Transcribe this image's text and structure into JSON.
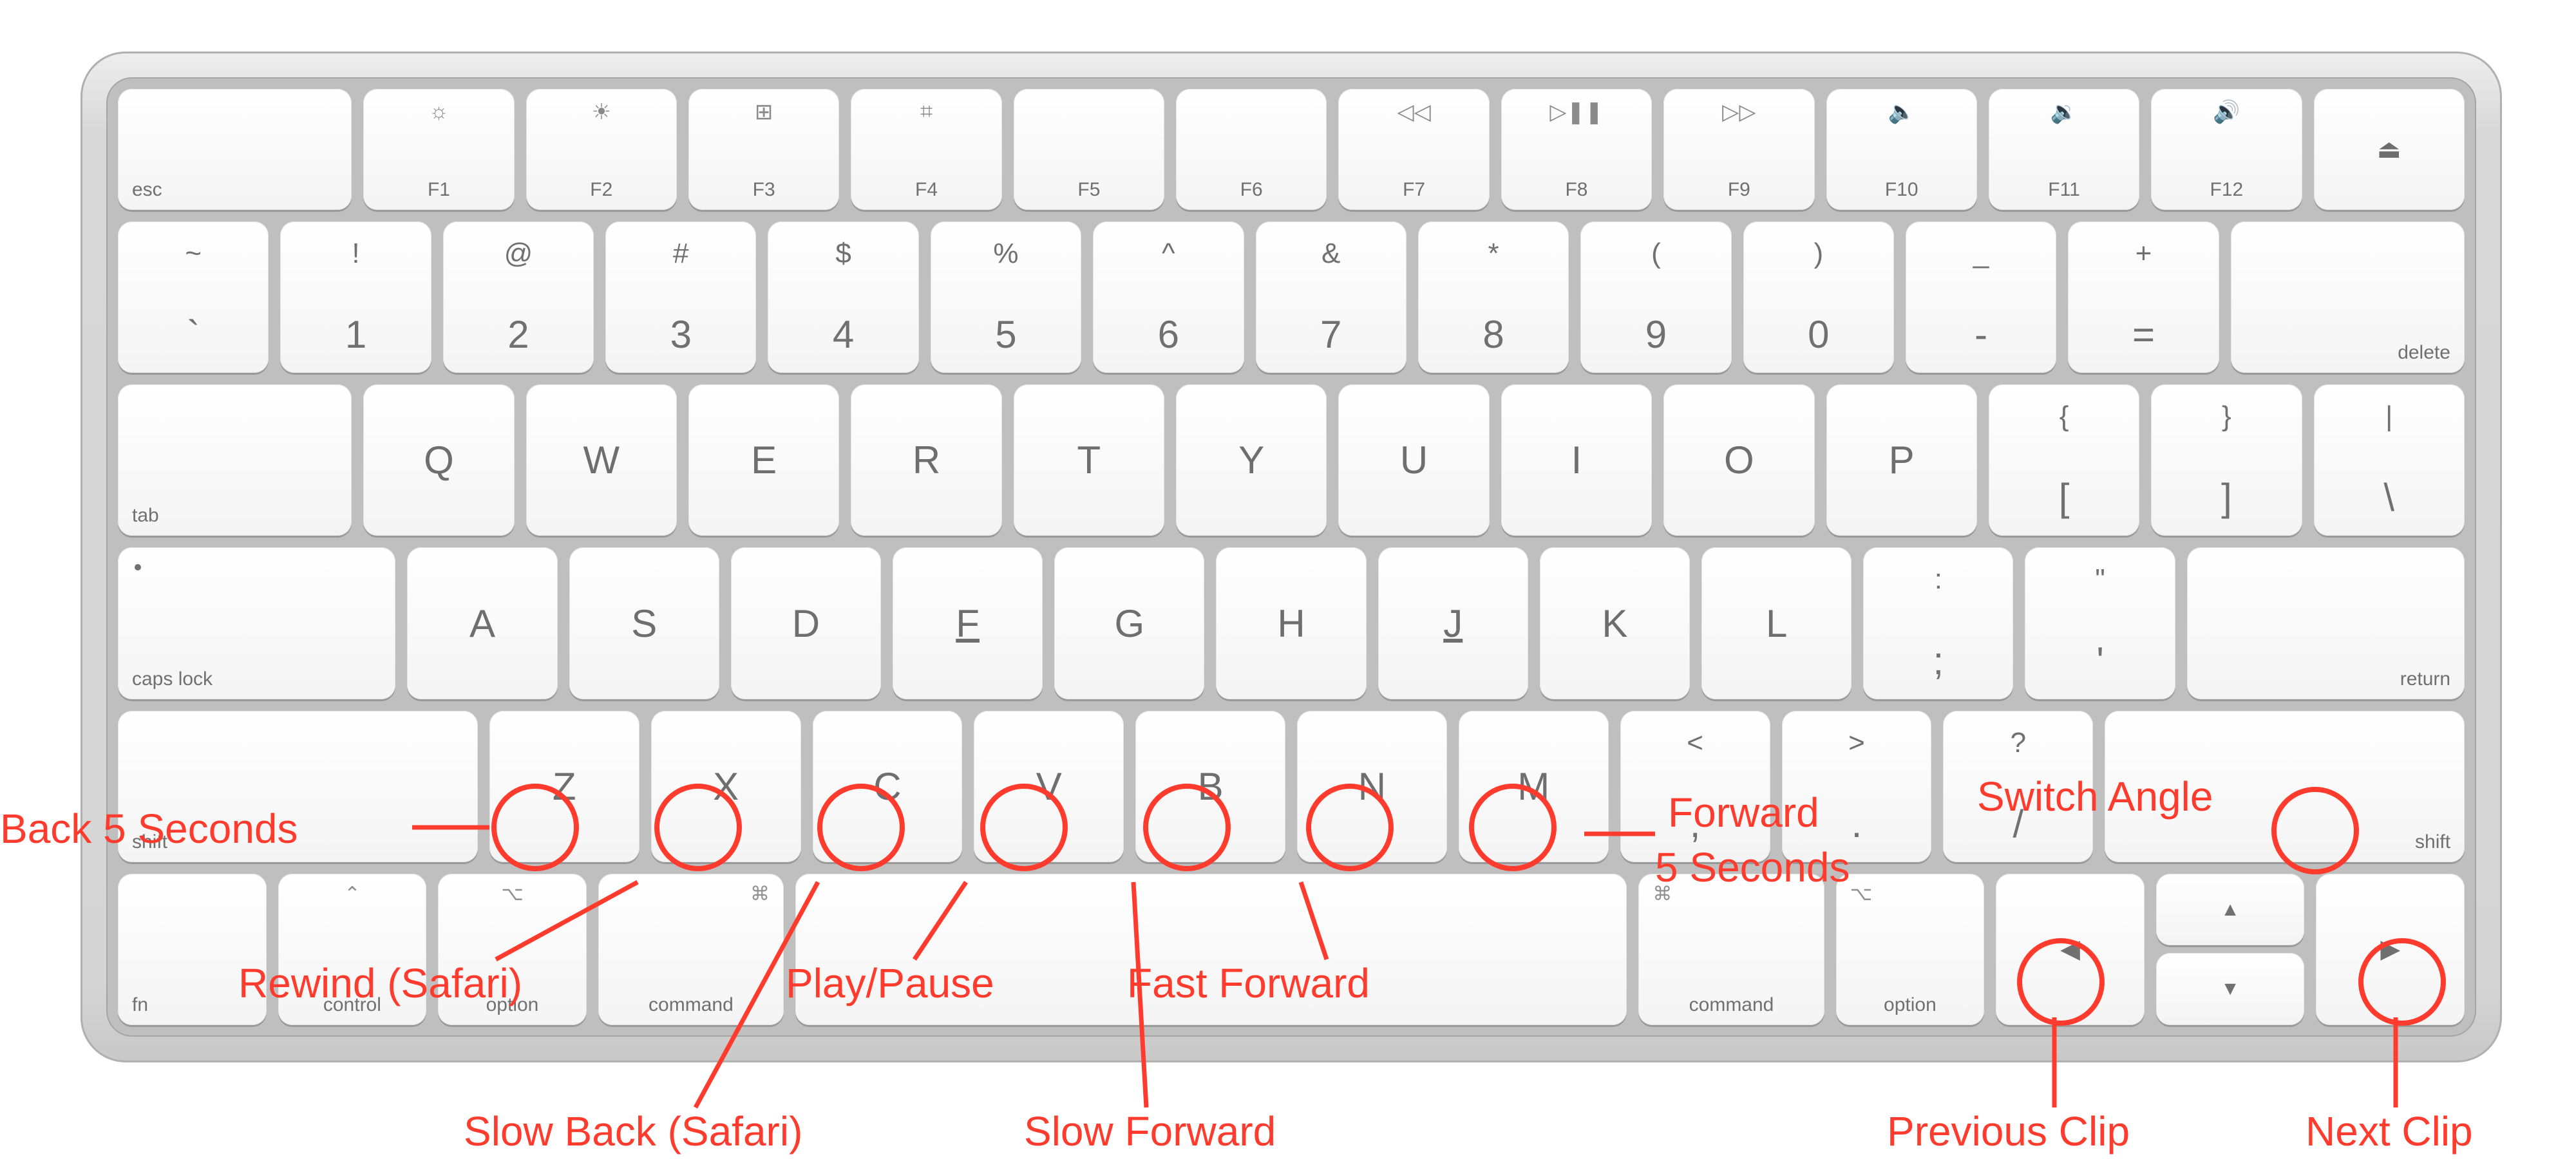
{
  "rowF": {
    "esc": "esc",
    "keys": [
      {
        "sub": "F1",
        "icon": "brightness-down-icon",
        "glyph": "☼"
      },
      {
        "sub": "F2",
        "icon": "brightness-up-icon",
        "glyph": "☀"
      },
      {
        "sub": "F3",
        "icon": "mission-control-icon",
        "glyph": "⊞"
      },
      {
        "sub": "F4",
        "icon": "launchpad-icon",
        "glyph": "⌗"
      },
      {
        "sub": "F5",
        "icon": "",
        "glyph": ""
      },
      {
        "sub": "F6",
        "icon": "",
        "glyph": ""
      },
      {
        "sub": "F7",
        "icon": "rewind-icon",
        "glyph": "◁◁"
      },
      {
        "sub": "F8",
        "icon": "play-pause-icon",
        "glyph": "▷❚❚"
      },
      {
        "sub": "F9",
        "icon": "fast-forward-icon",
        "glyph": "▷▷"
      },
      {
        "sub": "F10",
        "icon": "mute-icon",
        "glyph": "🔈"
      },
      {
        "sub": "F11",
        "icon": "vol-down-icon",
        "glyph": "🔉"
      },
      {
        "sub": "F12",
        "icon": "vol-up-icon",
        "glyph": "🔊"
      }
    ],
    "eject": "⏏"
  },
  "row1": {
    "keys": [
      {
        "top": "~",
        "bot": "`"
      },
      {
        "top": "!",
        "bot": "1"
      },
      {
        "top": "@",
        "bot": "2"
      },
      {
        "top": "#",
        "bot": "3"
      },
      {
        "top": "$",
        "bot": "4"
      },
      {
        "top": "%",
        "bot": "5"
      },
      {
        "top": "^",
        "bot": "6"
      },
      {
        "top": "&",
        "bot": "7"
      },
      {
        "top": "*",
        "bot": "8"
      },
      {
        "top": "(",
        "bot": "9"
      },
      {
        "top": ")",
        "bot": "0"
      },
      {
        "top": "_",
        "bot": "-"
      },
      {
        "top": "+",
        "bot": "="
      }
    ],
    "delete": "delete"
  },
  "row2": {
    "tab": "tab",
    "letters": [
      "Q",
      "W",
      "E",
      "R",
      "T",
      "Y",
      "U",
      "I",
      "O",
      "P"
    ],
    "brackets": [
      {
        "top": "{",
        "bot": "["
      },
      {
        "top": "}",
        "bot": "]"
      },
      {
        "top": "|",
        "bot": "\\"
      }
    ]
  },
  "row3": {
    "caps": "caps lock",
    "letters": [
      "A",
      "S",
      "D",
      "F",
      "G",
      "H",
      "J",
      "K",
      "L"
    ],
    "punct": [
      {
        "top": ":",
        "bot": ";"
      },
      {
        "top": "\"",
        "bot": "'"
      }
    ],
    "return": "return"
  },
  "row4": {
    "lshift": "shift",
    "letters": [
      "Z",
      "X",
      "C",
      "V",
      "B",
      "N",
      "M"
    ],
    "punct": [
      {
        "top": "<",
        "bot": ","
      },
      {
        "top": ">",
        "bot": "."
      },
      {
        "top": "?",
        "bot": "/"
      }
    ],
    "rshift": "shift"
  },
  "row5": {
    "fn": "fn",
    "control": "control",
    "optionL": "option",
    "commandL": "command",
    "commandR": "command",
    "optionR": "option",
    "cmdGlyph": "⌘",
    "optGlyph": "⌥",
    "ctlGlyph": "⌃",
    "arrows": {
      "left": "◀",
      "up": "▲",
      "down": "▼",
      "right": "▶"
    }
  },
  "annotations": {
    "back5": "Back 5 Seconds",
    "rewind": "Rewind (Safari)",
    "slowBack": "Slow Back (Safari)",
    "playPause": "Play/Pause",
    "slowForward": "Slow Forward",
    "fastForward": "Fast Forward",
    "forward5a": "Forward",
    "forward5b": "5 Seconds",
    "switchAngle": "Switch Angle",
    "prevClip": "Previous Clip",
    "nextClip": "Next Clip"
  }
}
